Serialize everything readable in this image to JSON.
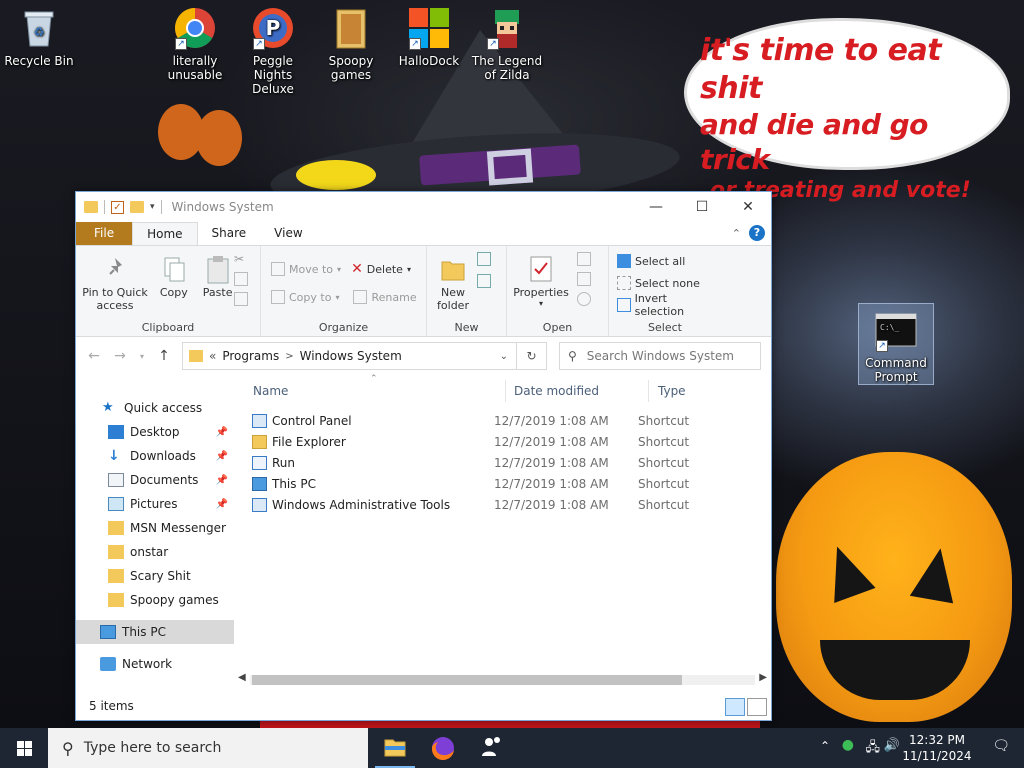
{
  "desktop": {
    "icons": [
      {
        "label": "Recycle Bin"
      },
      {
        "label": "literally unusable"
      },
      {
        "label": "Peggle Nights Deluxe"
      },
      {
        "label": "Spoopy games"
      },
      {
        "label": "HalloDock"
      },
      {
        "label": "The Legend of Zilda"
      },
      {
        "label": "Command Prompt"
      }
    ],
    "wallpaper_text": {
      "line1": "it's time to eat shit",
      "line2": "and die and go trick",
      "line3": "or treating and vote!"
    }
  },
  "explorer": {
    "title": "Windows System",
    "tabs": {
      "file": "File",
      "home": "Home",
      "share": "Share",
      "view": "View"
    },
    "ribbon": {
      "clipboard": {
        "label": "Clipboard",
        "pin": "Pin to Quick access",
        "copy": "Copy",
        "paste": "Paste"
      },
      "organize": {
        "label": "Organize",
        "move_to": "Move to",
        "copy_to": "Copy to",
        "delete": "Delete",
        "rename": "Rename"
      },
      "new": {
        "label": "New",
        "new_folder": "New folder"
      },
      "open": {
        "label": "Open",
        "properties": "Properties"
      },
      "select": {
        "label": "Select",
        "select_all": "Select all",
        "select_none": "Select none",
        "invert": "Invert selection"
      }
    },
    "address": {
      "crumbs": [
        "Programs",
        "Windows System"
      ],
      "search_placeholder": "Search Windows System"
    },
    "nav": {
      "quick_access": "Quick access",
      "items": [
        {
          "label": "Desktop",
          "pinned": true
        },
        {
          "label": "Downloads",
          "pinned": true
        },
        {
          "label": "Documents",
          "pinned": true
        },
        {
          "label": "Pictures",
          "pinned": true
        },
        {
          "label": "MSN Messenger"
        },
        {
          "label": "onstar"
        },
        {
          "label": "Scary Shit"
        },
        {
          "label": "Spoopy games"
        }
      ],
      "this_pc": "This PC",
      "network": "Network"
    },
    "columns": {
      "name": "Name",
      "date": "Date modified",
      "type": "Type"
    },
    "files": [
      {
        "name": "Control Panel",
        "date": "12/7/2019 1:08 AM",
        "type": "Shortcut"
      },
      {
        "name": "File Explorer",
        "date": "12/7/2019 1:08 AM",
        "type": "Shortcut"
      },
      {
        "name": "Run",
        "date": "12/7/2019 1:08 AM",
        "type": "Shortcut"
      },
      {
        "name": "This PC",
        "date": "12/7/2019 1:08 AM",
        "type": "Shortcut"
      },
      {
        "name": "Windows Administrative Tools",
        "date": "12/7/2019 1:08 AM",
        "type": "Shortcut"
      }
    ],
    "status": "5 items"
  },
  "taskbar": {
    "search_placeholder": "Type here to search",
    "time": "12:32 PM",
    "date": "11/11/2024"
  },
  "colors": {
    "accent": "#0078d7",
    "file_tab": "#b47a1e",
    "taskbar": "#1e2633",
    "selection": "#cde8ff"
  }
}
